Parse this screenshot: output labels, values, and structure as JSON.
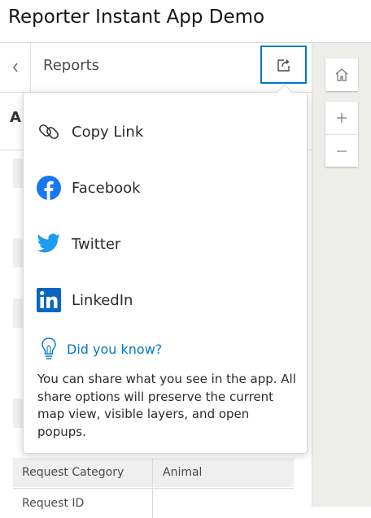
{
  "app": {
    "title": "Reporter Instant App Demo"
  },
  "panel": {
    "title": "Reports",
    "sub_letter": "A",
    "table": {
      "rows": [
        {
          "label": "Request Category",
          "value": "Animal"
        },
        {
          "label": "Request ID",
          "value": ""
        }
      ]
    }
  },
  "share": {
    "items": [
      {
        "label": "Copy Link",
        "icon": "link-icon"
      },
      {
        "label": "Facebook",
        "icon": "facebook-icon",
        "color": "#1877f2"
      },
      {
        "label": "Twitter",
        "icon": "twitter-icon",
        "color": "#1d9bf0"
      },
      {
        "label": "LinkedIn",
        "icon": "linkedin-icon",
        "color": "#0a66c2"
      }
    ],
    "tip": {
      "heading": "Did you know?",
      "text": "You can share what you see in the app. All share options will preserve the current map view, visible layers, and open popups."
    }
  },
  "colors": {
    "accent": "#007ac2",
    "map_bg": "#ededea"
  }
}
